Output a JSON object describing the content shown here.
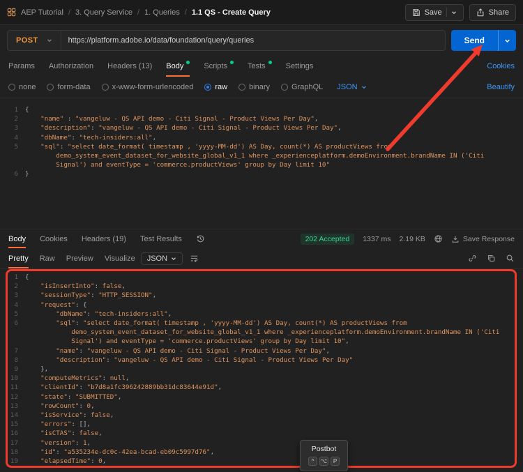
{
  "colors": {
    "method_post": "#f0973e",
    "accent_blue": "#0265d2",
    "link_blue": "#3e96f5",
    "success_green": "#3ecf8e",
    "dot_green": "#0acf83",
    "annotation_red": "#ee3b2d",
    "code_orange": "#df945e",
    "punctuation_gray": "#a6adb5"
  },
  "topbar": {
    "breadcrumb": [
      {
        "label": "AEP Tutorial",
        "current": false
      },
      {
        "label": "3. Query Service",
        "current": false
      },
      {
        "label": "1. Queries",
        "current": false
      },
      {
        "label": "1.1 QS - Create Query",
        "current": true
      }
    ],
    "save_label": "Save",
    "share_label": "Share"
  },
  "request": {
    "method": "POST",
    "url": "https://platform.adobe.io/data/foundation/query/queries",
    "send_label": "Send",
    "tabs": [
      {
        "label": "Params",
        "active": false
      },
      {
        "label": "Authorization",
        "active": false
      },
      {
        "label": "Headers",
        "count": "(13)",
        "active": false
      },
      {
        "label": "Body",
        "dot": true,
        "active": true
      },
      {
        "label": "Scripts",
        "dot": true,
        "active": false
      },
      {
        "label": "Tests",
        "dot": true,
        "active": false
      },
      {
        "label": "Settings",
        "active": false
      }
    ],
    "cookies_label": "Cookies",
    "body_types": [
      {
        "label": "none",
        "selected": false
      },
      {
        "label": "form-data",
        "selected": false
      },
      {
        "label": "x-www-form-urlencoded",
        "selected": false
      },
      {
        "label": "raw",
        "selected": true
      },
      {
        "label": "binary",
        "selected": false
      },
      {
        "label": "GraphQL",
        "selected": false
      }
    ],
    "language": "JSON",
    "beautify_label": "Beautify",
    "editor_lines": [
      {
        "n": "1",
        "t": [
          [
            "p",
            "{"
          ]
        ]
      },
      {
        "n": "2",
        "t": [
          [
            "p",
            "    "
          ],
          [
            "s",
            "\"name\""
          ],
          [
            "p",
            " : "
          ],
          [
            "s",
            "\"vangeluw - QS API demo - Citi Signal - Product Views Per Day\""
          ],
          [
            "p",
            ","
          ]
        ]
      },
      {
        "n": "3",
        "t": [
          [
            "p",
            "    "
          ],
          [
            "s",
            "\"description\""
          ],
          [
            "p",
            ": "
          ],
          [
            "s",
            "\"vangeluw - QS API demo - Citi Signal - Product Views Per Day\""
          ],
          [
            "p",
            ","
          ]
        ]
      },
      {
        "n": "4",
        "t": [
          [
            "p",
            "    "
          ],
          [
            "s",
            "\"dbName\""
          ],
          [
            "p",
            ": "
          ],
          [
            "s",
            "\"tech-insiders:all\""
          ],
          [
            "p",
            ","
          ]
        ]
      },
      {
        "n": "5",
        "t": [
          [
            "p",
            "    "
          ],
          [
            "s",
            "\"sql\""
          ],
          [
            "p",
            ": "
          ],
          [
            "s",
            "\"select date_format( timestamp , 'yyyy-MM-dd') AS Day, count(*) AS productViews from"
          ]
        ]
      },
      {
        "n": "",
        "t": [
          [
            "s",
            "        demo_system_event_dataset_for_website_global_v1_1 where _experienceplatform.demoEnvironment.brandName IN ('Citi"
          ]
        ]
      },
      {
        "n": "",
        "t": [
          [
            "s",
            "        Signal') and eventType = 'commerce.productViews' group by Day limit 10\""
          ]
        ]
      },
      {
        "n": "6",
        "t": [
          [
            "p",
            "}"
          ]
        ]
      }
    ]
  },
  "response": {
    "tabs": [
      {
        "label": "Body",
        "active": true
      },
      {
        "label": "Cookies",
        "active": false
      },
      {
        "label": "Headers",
        "count": "(19)",
        "active": false
      },
      {
        "label": "Test Results",
        "active": false
      }
    ],
    "status": "202 Accepted",
    "time": "1337 ms",
    "size": "2.19 KB",
    "save_response_label": "Save Response",
    "view_tabs": [
      {
        "label": "Pretty",
        "active": true
      },
      {
        "label": "Raw",
        "active": false
      },
      {
        "label": "Preview",
        "active": false
      },
      {
        "label": "Visualize",
        "active": false
      }
    ],
    "language": "JSON",
    "editor_lines": [
      {
        "n": "1",
        "t": [
          [
            "p",
            "{"
          ]
        ]
      },
      {
        "n": "2",
        "t": [
          [
            "p",
            "    "
          ],
          [
            "s",
            "\"isInsertInto\""
          ],
          [
            "p",
            ": "
          ],
          [
            "k",
            "false"
          ],
          [
            "p",
            ","
          ]
        ]
      },
      {
        "n": "3",
        "t": [
          [
            "p",
            "    "
          ],
          [
            "s",
            "\"sessionType\""
          ],
          [
            "p",
            ": "
          ],
          [
            "s",
            "\"HTTP_SESSION\""
          ],
          [
            "p",
            ","
          ]
        ]
      },
      {
        "n": "4",
        "t": [
          [
            "p",
            "    "
          ],
          [
            "s",
            "\"request\""
          ],
          [
            "p",
            ": {"
          ]
        ]
      },
      {
        "n": "5",
        "t": [
          [
            "p",
            "        "
          ],
          [
            "s",
            "\"dbName\""
          ],
          [
            "p",
            ": "
          ],
          [
            "s",
            "\"tech-insiders:all\""
          ],
          [
            "p",
            ","
          ]
        ]
      },
      {
        "n": "6",
        "t": [
          [
            "p",
            "        "
          ],
          [
            "s",
            "\"sql\""
          ],
          [
            "p",
            ": "
          ],
          [
            "s",
            "\"select date_format( timestamp , 'yyyy-MM-dd') AS Day, count(*) AS productViews from"
          ]
        ]
      },
      {
        "n": "",
        "t": [
          [
            "s",
            "            demo_system_event_dataset_for_website_global_v1_1 where _experienceplatform.demoEnvironment.brandName IN ('Citi"
          ]
        ]
      },
      {
        "n": "",
        "t": [
          [
            "s",
            "            Signal') and eventType = 'commerce.productViews' group by Day limit 10\""
          ],
          [
            "p",
            ","
          ]
        ]
      },
      {
        "n": "7",
        "t": [
          [
            "p",
            "        "
          ],
          [
            "s",
            "\"name\""
          ],
          [
            "p",
            ": "
          ],
          [
            "s",
            "\"vangeluw - QS API demo - Citi Signal - Product Views Per Day\""
          ],
          [
            "p",
            ","
          ]
        ]
      },
      {
        "n": "8",
        "t": [
          [
            "p",
            "        "
          ],
          [
            "s",
            "\"description\""
          ],
          [
            "p",
            ": "
          ],
          [
            "s",
            "\"vangeluw - QS API demo - Citi Signal - Product Views Per Day\""
          ]
        ]
      },
      {
        "n": "9",
        "t": [
          [
            "p",
            "    },"
          ]
        ]
      },
      {
        "n": "10",
        "t": [
          [
            "p",
            "    "
          ],
          [
            "s",
            "\"computeMetrics\""
          ],
          [
            "p",
            ": "
          ],
          [
            "k",
            "null"
          ],
          [
            "p",
            ","
          ]
        ]
      },
      {
        "n": "11",
        "t": [
          [
            "p",
            "    "
          ],
          [
            "s",
            "\"clientId\""
          ],
          [
            "p",
            ": "
          ],
          [
            "s",
            "\"b7d8a1fc396242889bb31dc83644e91d\""
          ],
          [
            "p",
            ","
          ]
        ]
      },
      {
        "n": "12",
        "t": [
          [
            "p",
            "    "
          ],
          [
            "s",
            "\"state\""
          ],
          [
            "p",
            ": "
          ],
          [
            "s",
            "\"SUBMITTED\""
          ],
          [
            "p",
            ","
          ]
        ]
      },
      {
        "n": "13",
        "t": [
          [
            "p",
            "    "
          ],
          [
            "s",
            "\"rowCount\""
          ],
          [
            "p",
            ": "
          ],
          [
            "k",
            "0"
          ],
          [
            "p",
            ","
          ]
        ]
      },
      {
        "n": "14",
        "t": [
          [
            "p",
            "    "
          ],
          [
            "s",
            "\"isService\""
          ],
          [
            "p",
            ": "
          ],
          [
            "k",
            "false"
          ],
          [
            "p",
            ","
          ]
        ]
      },
      {
        "n": "15",
        "t": [
          [
            "p",
            "    "
          ],
          [
            "s",
            "\"errors\""
          ],
          [
            "p",
            ": [],"
          ]
        ]
      },
      {
        "n": "16",
        "t": [
          [
            "p",
            "    "
          ],
          [
            "s",
            "\"isCTAS\""
          ],
          [
            "p",
            ": "
          ],
          [
            "k",
            "false"
          ],
          [
            "p",
            ","
          ]
        ]
      },
      {
        "n": "17",
        "t": [
          [
            "p",
            "    "
          ],
          [
            "s",
            "\"version\""
          ],
          [
            "p",
            ": "
          ],
          [
            "k",
            "1"
          ],
          [
            "p",
            ","
          ]
        ]
      },
      {
        "n": "18",
        "t": [
          [
            "p",
            "    "
          ],
          [
            "s",
            "\"id\""
          ],
          [
            "p",
            ": "
          ],
          [
            "s",
            "\"a535234e-dc0c-42ea-bcad-eb09c5997d76\""
          ],
          [
            "p",
            ","
          ]
        ]
      },
      {
        "n": "19",
        "t": [
          [
            "p",
            "    "
          ],
          [
            "s",
            "\"elapsedTime\""
          ],
          [
            "p",
            ": "
          ],
          [
            "k",
            "0"
          ],
          [
            "p",
            ","
          ]
        ]
      }
    ]
  },
  "postbot": {
    "title": "Postbot",
    "keys": [
      "^",
      "⌥",
      "P"
    ]
  }
}
